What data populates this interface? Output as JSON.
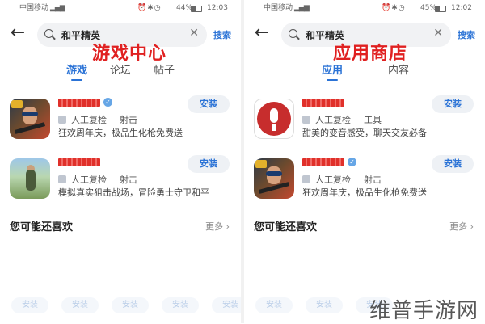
{
  "left": {
    "status": {
      "carrier": "中国移动",
      "battery": "44%",
      "time": "12:03"
    },
    "search": {
      "query": "和平精英",
      "button": "搜索"
    },
    "overlay_title": "游戏中心",
    "tabs": [
      {
        "label": "游戏"
      },
      {
        "label": "论坛"
      },
      {
        "label": "帖子"
      }
    ],
    "apps": [
      {
        "developer": "人工复检",
        "category": "射击",
        "description": "狂欢周年庆，极品生化枪免费送",
        "install": "安装"
      },
      {
        "developer": "人工复检",
        "category": "射击",
        "description": "模拟真实狙击战场，冒险勇士守卫和平",
        "install": "安装"
      }
    ],
    "recommend": {
      "title": "您可能还喜欢",
      "more": "更多"
    },
    "bottom_buttons": [
      "安装",
      "安装",
      "安装",
      "安装",
      "安装"
    ]
  },
  "right": {
    "status": {
      "carrier": "中国移动",
      "battery": "45%",
      "time": "12:02"
    },
    "search": {
      "query": "和平精英",
      "button": "搜索"
    },
    "overlay_title": "应用商店",
    "tabs": [
      {
        "label": "应用"
      },
      {
        "label": "内容"
      }
    ],
    "apps": [
      {
        "developer": "人工复检",
        "category": "工具",
        "description": "甜美的变音感受，聊天交友必备",
        "install": "安装"
      },
      {
        "developer": "人工复检",
        "category": "射击",
        "description": "狂欢周年庆，极品生化枪免费送",
        "install": "安装"
      }
    ],
    "recommend": {
      "title": "您可能还喜欢",
      "more": "更多"
    },
    "bottom_buttons": [
      "安装",
      "安装",
      "安装"
    ]
  },
  "watermark": "维普手游网",
  "colors": {
    "accent": "#2b73d6",
    "overlay": "#e02020",
    "redaction": "#e0302a"
  }
}
